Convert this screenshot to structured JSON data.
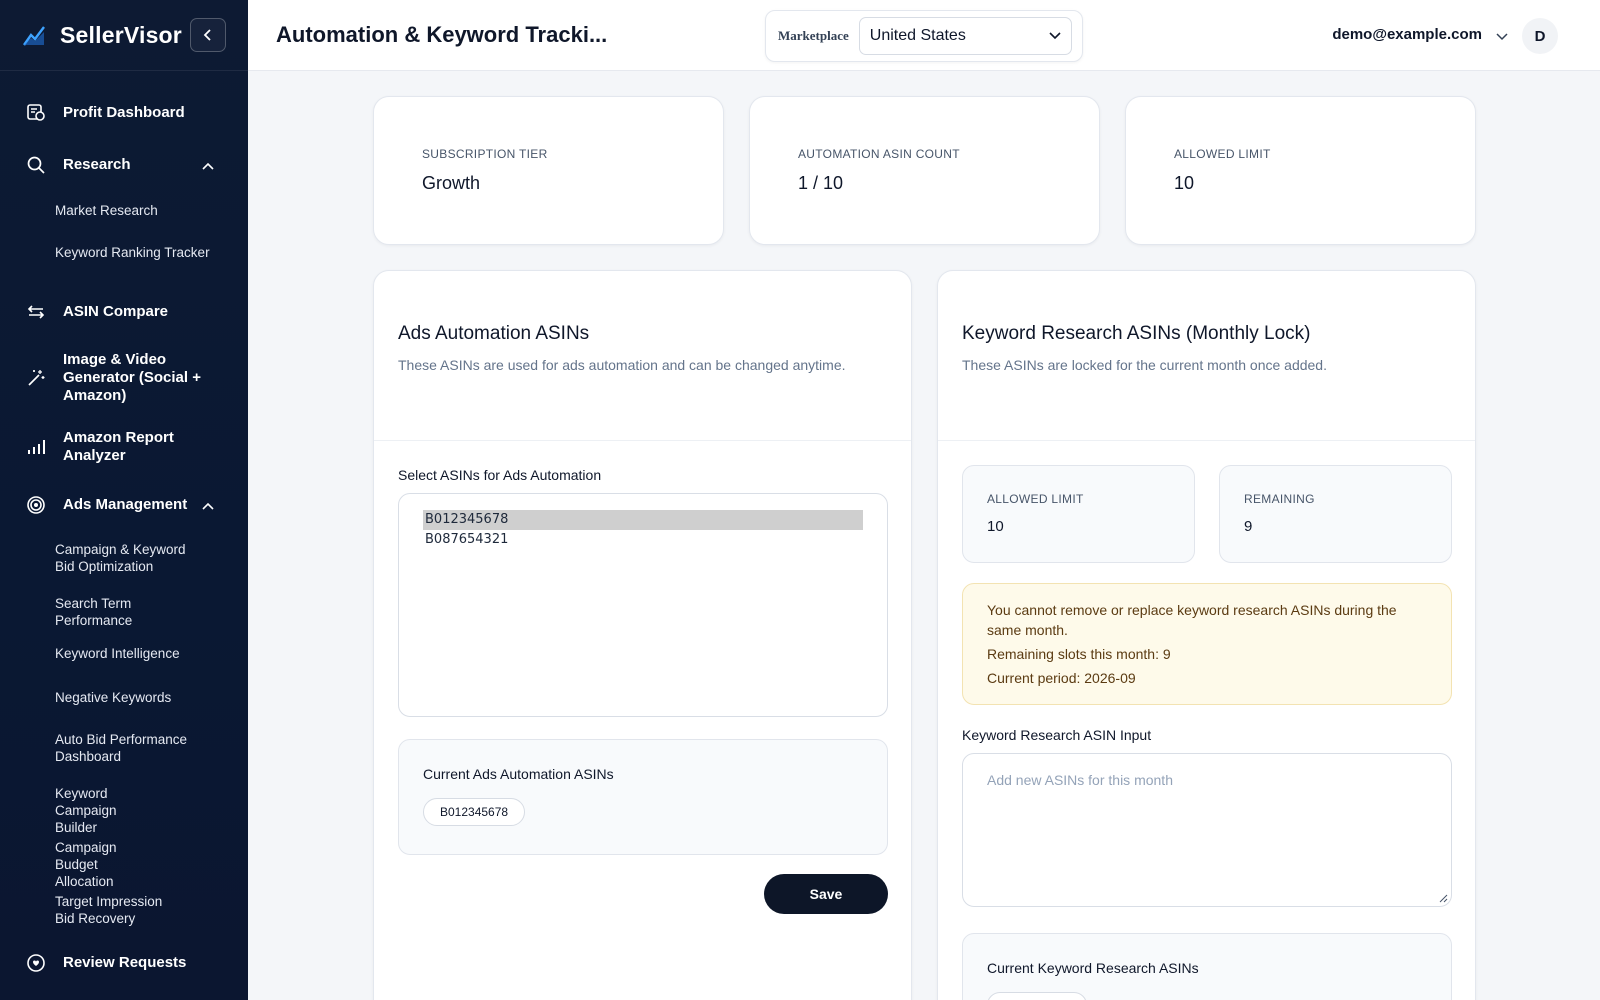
{
  "brand": {
    "name": "SellerVisor"
  },
  "sidebar": {
    "items": [
      {
        "label": "Profit Dashboard"
      },
      {
        "label": "Research",
        "children": [
          "Market Research",
          "Keyword Ranking Tracker"
        ]
      },
      {
        "label": "ASIN Compare"
      },
      {
        "label": "Image & Video Generator (Social + Amazon)"
      },
      {
        "label": "Amazon Report Analyzer"
      },
      {
        "label": "Ads Management",
        "children": [
          "Campaign & Keyword Bid Optimization",
          "Search Term Performance",
          "Keyword Intelligence",
          "Negative Keywords",
          "Auto Bid Performance Dashboard",
          "Keyword Campaign Builder",
          "Campaign Budget Allocation",
          "Target Impression Bid Recovery"
        ]
      },
      {
        "label": "Review Requests"
      }
    ]
  },
  "header": {
    "title": "Automation & Keyword Tracki...",
    "marketplace_label": "Marketplace",
    "marketplace_value": "United States",
    "user_email": "demo@example.com",
    "avatar_initial": "D"
  },
  "stats": [
    {
      "label": "SUBSCRIPTION TIER",
      "value": "Growth"
    },
    {
      "label": "AUTOMATION ASIN COUNT",
      "value": "1 / 10"
    },
    {
      "label": "ALLOWED LIMIT",
      "value": "10"
    }
  ],
  "ads_panel": {
    "title": "Ads Automation ASINs",
    "description": "These ASINs are used for ads automation and can be changed anytime.",
    "select_label": "Select ASINs for Ads Automation",
    "options": [
      "B012345678",
      "B087654321"
    ],
    "selected_option": "B012345678",
    "current_title": "Current Ads Automation ASINs",
    "current_asins": [
      "B012345678"
    ],
    "save_label": "Save"
  },
  "keyword_panel": {
    "title": "Keyword Research ASINs (Monthly Lock)",
    "description": "These ASINs are locked for the current month once added.",
    "allowed_label": "ALLOWED LIMIT",
    "allowed_value": "10",
    "remaining_label": "REMAINING",
    "remaining_value": "9",
    "warning_lines": [
      "You cannot remove or replace keyword research ASINs during the same month.",
      "Remaining slots this month: 9",
      "Current period: 2026-09"
    ],
    "input_label": "Keyword Research ASIN Input",
    "input_placeholder": "Add new ASINs for this month",
    "current_title": "Current Keyword Research ASINs"
  },
  "colors": {
    "sidebar_bg": "#0d1a33",
    "accent": "#0d1628",
    "warning_bg": "#fefaea"
  }
}
